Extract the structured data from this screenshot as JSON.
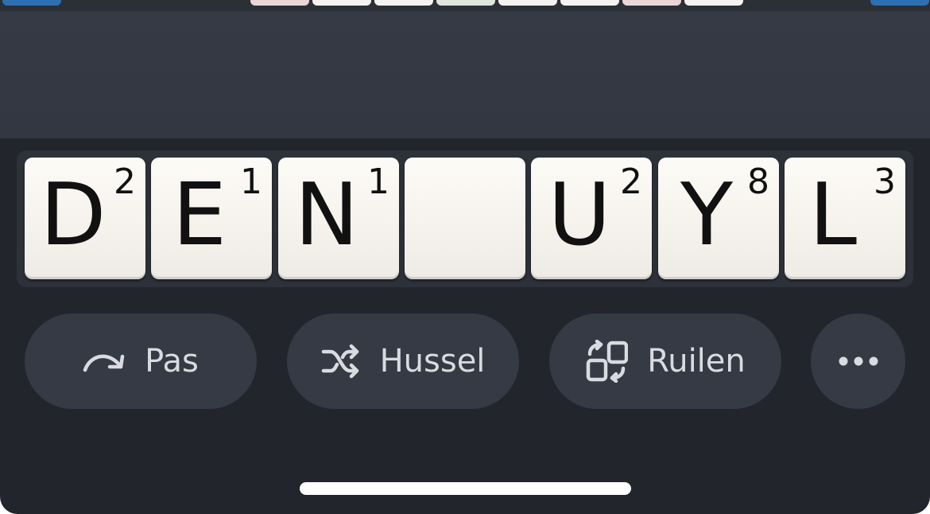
{
  "board_row_colors": [
    "#2e6fb1",
    "#2b2f36",
    "#2b2f36",
    "#2b2f36",
    "#e8d7d6",
    "#f5f3ef",
    "#f5f3ef",
    "#dfe4dc",
    "#f5f3ef",
    "#f5f3ef",
    "#e8d7d6",
    "#f5f3ef",
    "#2b2f36",
    "#2b2f36",
    "#2e6fb1"
  ],
  "rack": {
    "tiles": [
      {
        "letter": "D",
        "score": "2"
      },
      {
        "letter": "E",
        "score": "1"
      },
      {
        "letter": "N",
        "score": "1"
      },
      {
        "letter": "",
        "score": ""
      },
      {
        "letter": "U",
        "score": "2"
      },
      {
        "letter": "Y",
        "score": "8"
      },
      {
        "letter": "L",
        "score": "3"
      }
    ]
  },
  "actions": {
    "pass": {
      "label": "Pas",
      "icon": "redo-arrow-icon"
    },
    "shuffle": {
      "label": "Hussel",
      "icon": "shuffle-icon"
    },
    "swap": {
      "label": "Ruilen",
      "icon": "swap-tiles-icon"
    },
    "more": {
      "icon": "more-dots-icon"
    }
  },
  "colors": {
    "background": "#22252b",
    "button": "#353a44",
    "tile": "#f7f4ee",
    "text": "#d9dbe0"
  }
}
